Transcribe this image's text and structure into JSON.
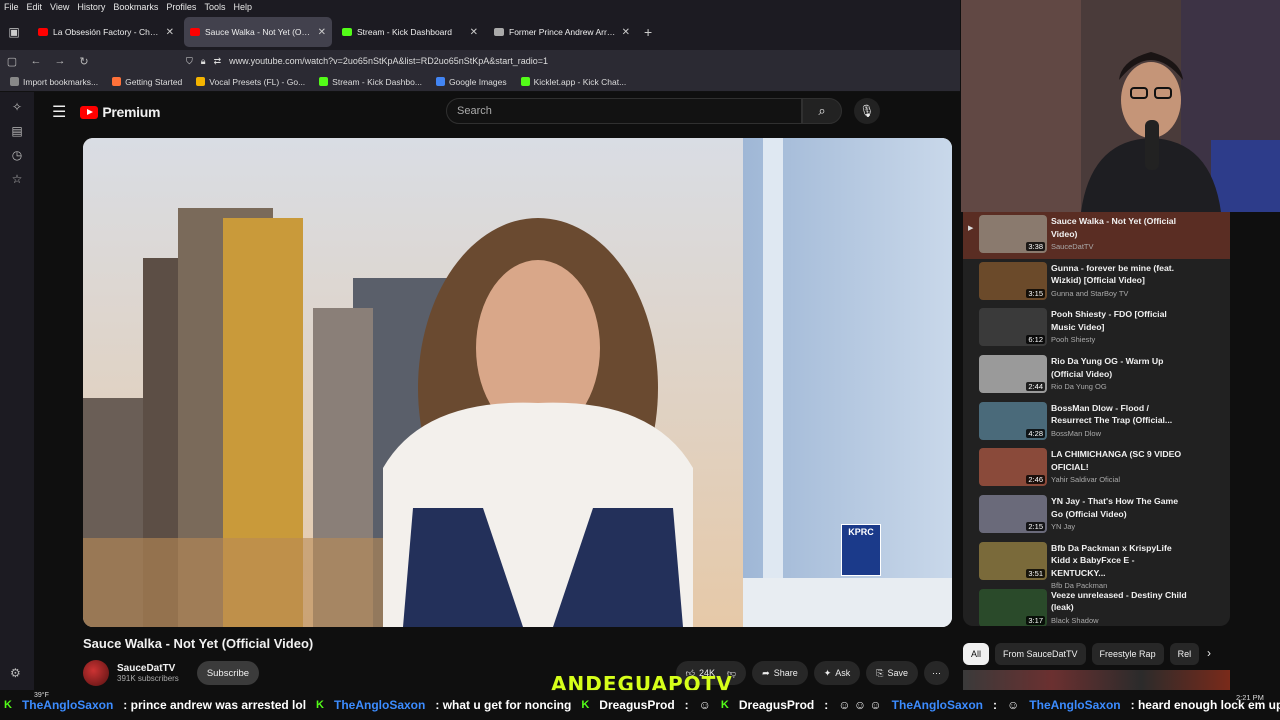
{
  "menubar": [
    "File",
    "Edit",
    "View",
    "History",
    "Bookmarks",
    "Profiles",
    "Tools",
    "Help"
  ],
  "tabs": [
    {
      "title": "La Obsesión Factory - Chichabe",
      "color": "#ff0000",
      "active": false
    },
    {
      "title": "Sauce Walka - Not Yet (Official",
      "color": "#ff0000",
      "active": true
    },
    {
      "title": "Stream - Kick Dashboard",
      "color": "#53fc18",
      "active": false
    },
    {
      "title": "Former Prince Andrew Arrested",
      "color": "#aaaaaa",
      "active": false
    }
  ],
  "address": {
    "url": "www.youtube.com/watch?v=2uo65nStKpA&list=RD2uo65nStKpA&start_radio=1"
  },
  "bookmarks": [
    {
      "label": "Import bookmarks...",
      "color": "#888888"
    },
    {
      "label": "Getting Started",
      "color": "#ff7139"
    },
    {
      "label": "Vocal Presets (FL) - Go...",
      "color": "#f4b400"
    },
    {
      "label": "Stream - Kick Dashbo...",
      "color": "#53fc18"
    },
    {
      "label": "Google Images",
      "color": "#4285f4"
    },
    {
      "label": "Kicklet.app - Kick Chat...",
      "color": "#53fc18"
    }
  ],
  "header": {
    "logo_text": "Premium",
    "search_placeholder": "Search"
  },
  "video": {
    "title": "Sauce Walka - Not Yet (Official Video)",
    "channel": "SauceDatTV",
    "subscribers": "391K subscribers",
    "subscribe_label": "Subscribe",
    "likes": "24K",
    "share_label": "Share",
    "ask_label": "Ask",
    "save_label": "Save",
    "station_logo": "KPRC"
  },
  "playlist": [
    {
      "title": "Sauce Walka - Not Yet (Official Video)",
      "channel": "SauceDatTV",
      "duration": "3:38",
      "current": true,
      "thumb": "#8a7a6e"
    },
    {
      "title": "Gunna - forever be mine (feat. Wizkid) [Official Video]",
      "channel": "Gunna and StarBoy TV",
      "duration": "3:15",
      "current": false,
      "thumb": "#6b4a2a"
    },
    {
      "title": "Pooh Shiesty - FDO [Official Music Video]",
      "channel": "Pooh Shiesty",
      "duration": "6:12",
      "current": false,
      "thumb": "#3a3a3a"
    },
    {
      "title": "Rio Da Yung OG - Warm Up (Official Video)",
      "channel": "Rio Da Yung OG",
      "duration": "2:44",
      "current": false,
      "thumb": "#9a9a9a"
    },
    {
      "title": "BossMan Dlow - Flood / Resurrect The Trap (Official...",
      "channel": "BossMan Dlow",
      "duration": "4:28",
      "current": false,
      "thumb": "#4a6a7a"
    },
    {
      "title": "LA CHIMICHANGA (SC 9 VIDEO OFICIAL!",
      "channel": "Yahir Saldivar Oficial",
      "duration": "2:46",
      "current": false,
      "thumb": "#8a4a3a"
    },
    {
      "title": "YN Jay - That's How The Game Go (Official Video)",
      "channel": "YN Jay",
      "duration": "2:15",
      "current": false,
      "thumb": "#6a6a7a"
    },
    {
      "title": "Bfb Da Packman x KrispyLife Kidd x BabyFxce E - KENTUCKY...",
      "channel": "Bfb Da Packman",
      "duration": "3:51",
      "current": false,
      "thumb": "#7a6a3a"
    },
    {
      "title": "Veeze unreleased - Destiny Child (leak)",
      "channel": "Black Shadow",
      "duration": "3:17",
      "current": false,
      "thumb": "#2a4a2a"
    }
  ],
  "chips": [
    "All",
    "From SauceDatTV",
    "Freestyle Rap",
    "Rel"
  ],
  "overlay_name": "ANDEGUAPOTV",
  "weather": "39°F",
  "clock": "2:21 PM",
  "chat": [
    {
      "user": "TheAngloSaxon",
      "msg": "prince andrew was arrested lol"
    },
    {
      "user": "TheAngloSaxon",
      "msg": "what u get for noncing"
    },
    {
      "user": "DreagusProd",
      "msg": ""
    },
    {
      "user": "DreagusProd",
      "msg": ""
    },
    {
      "user": "TheAngloSaxon",
      "msg": ""
    },
    {
      "user": "TheAngloSaxon",
      "msg": "heard enough lock em up"
    }
  ]
}
